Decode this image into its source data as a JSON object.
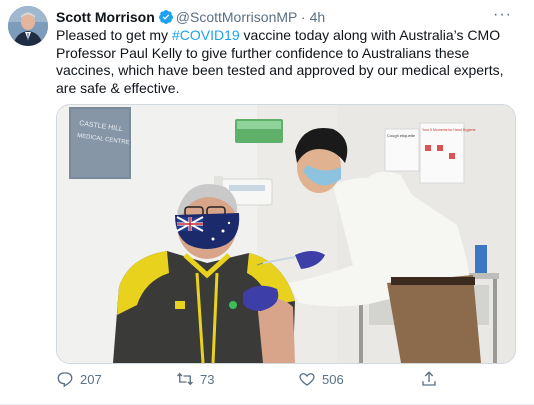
{
  "tweet": {
    "author_name": "Scott Morrison",
    "handle": "@ScottMorrisonMP",
    "separator": "·",
    "time": "4h",
    "more": "···",
    "text_before": "Pleased to get my ",
    "hashtag": "#COVID19",
    "text_after": " vaccine today along with Australia’s CMO Professor Paul Kelly to give further confidence to Australians these vaccines, which have been tested and approved by our medical experts, are safe & effective."
  },
  "photo": {
    "wall_sign_line1": "CASTLE HILL",
    "wall_sign_line2": "MEDICAL CENTRE",
    "poster_title": "Cough etiquette",
    "poster2_title": "Your 5 Moments for Hand Hygiene"
  },
  "actions": {
    "reply_count": "207",
    "retweet_count": "73",
    "like_count": "506"
  },
  "icons": {
    "verified": "verified-badge-icon",
    "reply": "reply-icon",
    "retweet": "retweet-icon",
    "like": "heart-icon",
    "share": "share-icon"
  },
  "colors": {
    "accent": "#1da1f2",
    "secondary_text": "#5b7083"
  }
}
